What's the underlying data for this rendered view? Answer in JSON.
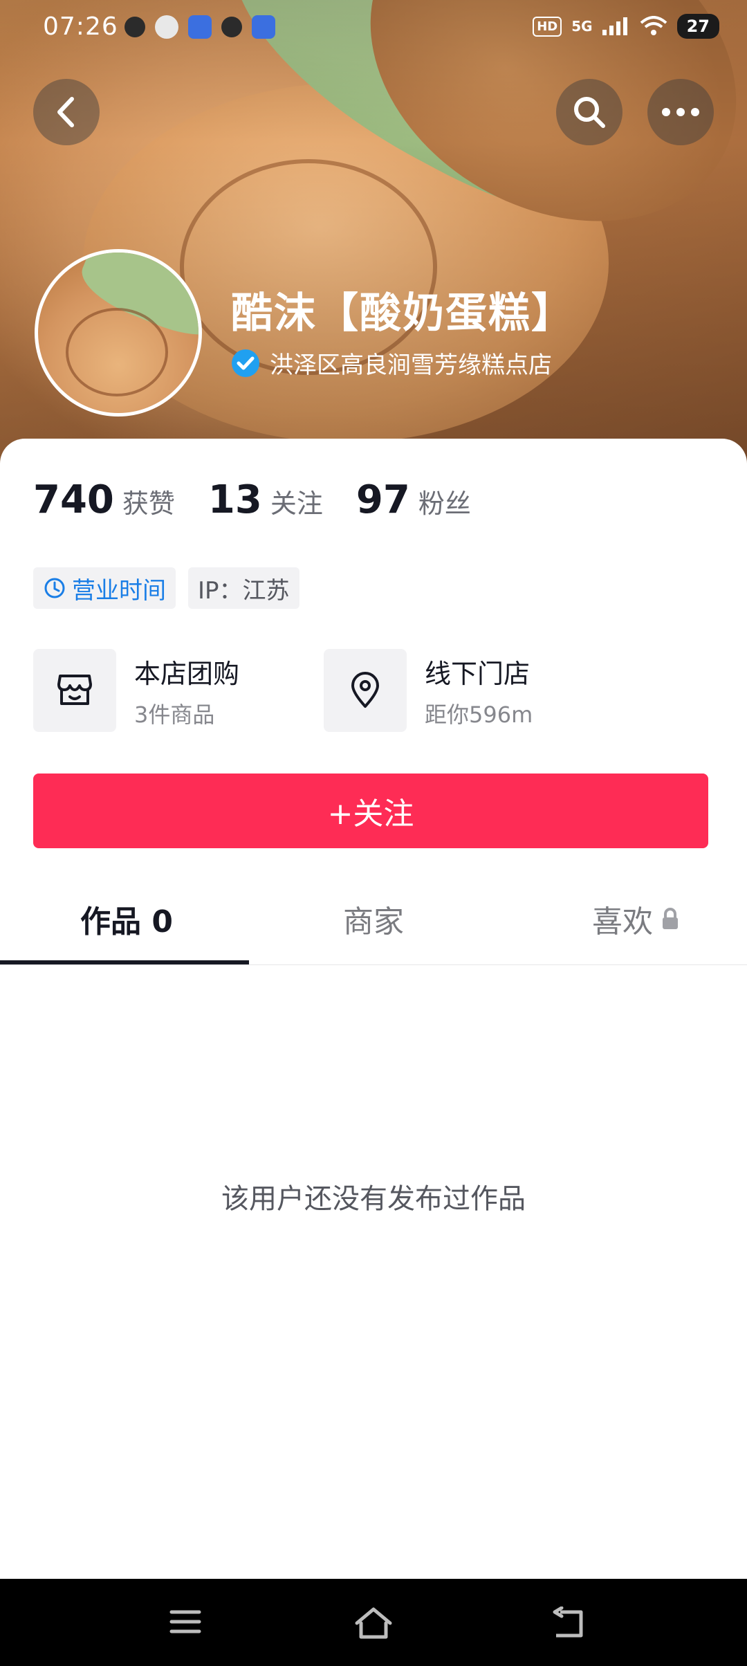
{
  "status_bar": {
    "time": "07:26",
    "hd": "HD",
    "signal": "5G",
    "battery": "27"
  },
  "header": {
    "shop_name": "酷沫【酸奶蛋糕】",
    "verified_name": "洪泽区高良涧雪芳缘糕点店"
  },
  "stats": [
    {
      "num": "740",
      "label": "获赞"
    },
    {
      "num": "13",
      "label": "关注"
    },
    {
      "num": "97",
      "label": "粉丝"
    }
  ],
  "tags": {
    "hours": "营业时间",
    "ip": "IP：江苏"
  },
  "services": {
    "group_buy_title": "本店团购",
    "group_buy_sub": "3件商品",
    "store_title": "线下门店",
    "store_sub": "距你596m"
  },
  "follow_button": "+关注",
  "tabs": {
    "works": "作品 0",
    "merchant": "商家",
    "likes": "喜欢"
  },
  "empty_message": "该用户还没有发布过作品",
  "colors": {
    "accent": "#fe2c55",
    "link_blue": "#1a7ee6",
    "verify_blue": "#20a0f0"
  },
  "icons": {
    "back": "back-icon",
    "search": "search-icon",
    "more": "more-icon",
    "verified": "verified-icon",
    "clock": "clock-icon",
    "store": "store-icon",
    "location": "location-pin-icon",
    "lock": "lock-icon"
  }
}
